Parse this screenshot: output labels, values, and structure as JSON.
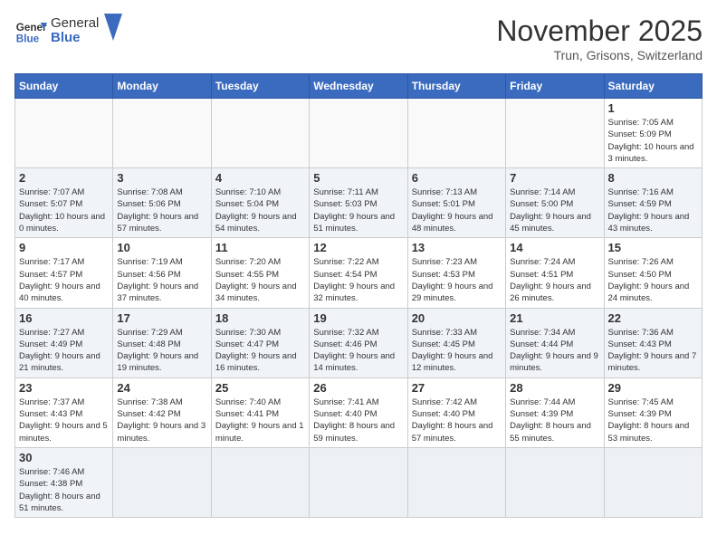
{
  "header": {
    "logo_general": "General",
    "logo_blue": "Blue",
    "month": "November 2025",
    "location": "Trun, Grisons, Switzerland"
  },
  "weekdays": [
    "Sunday",
    "Monday",
    "Tuesday",
    "Wednesday",
    "Thursday",
    "Friday",
    "Saturday"
  ],
  "weeks": [
    [
      {
        "day": "",
        "info": ""
      },
      {
        "day": "",
        "info": ""
      },
      {
        "day": "",
        "info": ""
      },
      {
        "day": "",
        "info": ""
      },
      {
        "day": "",
        "info": ""
      },
      {
        "day": "",
        "info": ""
      },
      {
        "day": "1",
        "info": "Sunrise: 7:05 AM\nSunset: 5:09 PM\nDaylight: 10 hours\nand 3 minutes."
      }
    ],
    [
      {
        "day": "2",
        "info": "Sunrise: 7:07 AM\nSunset: 5:07 PM\nDaylight: 10 hours\nand 0 minutes."
      },
      {
        "day": "3",
        "info": "Sunrise: 7:08 AM\nSunset: 5:06 PM\nDaylight: 9 hours\nand 57 minutes."
      },
      {
        "day": "4",
        "info": "Sunrise: 7:10 AM\nSunset: 5:04 PM\nDaylight: 9 hours\nand 54 minutes."
      },
      {
        "day": "5",
        "info": "Sunrise: 7:11 AM\nSunset: 5:03 PM\nDaylight: 9 hours\nand 51 minutes."
      },
      {
        "day": "6",
        "info": "Sunrise: 7:13 AM\nSunset: 5:01 PM\nDaylight: 9 hours\nand 48 minutes."
      },
      {
        "day": "7",
        "info": "Sunrise: 7:14 AM\nSunset: 5:00 PM\nDaylight: 9 hours\nand 45 minutes."
      },
      {
        "day": "8",
        "info": "Sunrise: 7:16 AM\nSunset: 4:59 PM\nDaylight: 9 hours\nand 43 minutes."
      }
    ],
    [
      {
        "day": "9",
        "info": "Sunrise: 7:17 AM\nSunset: 4:57 PM\nDaylight: 9 hours\nand 40 minutes."
      },
      {
        "day": "10",
        "info": "Sunrise: 7:19 AM\nSunset: 4:56 PM\nDaylight: 9 hours\nand 37 minutes."
      },
      {
        "day": "11",
        "info": "Sunrise: 7:20 AM\nSunset: 4:55 PM\nDaylight: 9 hours\nand 34 minutes."
      },
      {
        "day": "12",
        "info": "Sunrise: 7:22 AM\nSunset: 4:54 PM\nDaylight: 9 hours\nand 32 minutes."
      },
      {
        "day": "13",
        "info": "Sunrise: 7:23 AM\nSunset: 4:53 PM\nDaylight: 9 hours\nand 29 minutes."
      },
      {
        "day": "14",
        "info": "Sunrise: 7:24 AM\nSunset: 4:51 PM\nDaylight: 9 hours\nand 26 minutes."
      },
      {
        "day": "15",
        "info": "Sunrise: 7:26 AM\nSunset: 4:50 PM\nDaylight: 9 hours\nand 24 minutes."
      }
    ],
    [
      {
        "day": "16",
        "info": "Sunrise: 7:27 AM\nSunset: 4:49 PM\nDaylight: 9 hours\nand 21 minutes."
      },
      {
        "day": "17",
        "info": "Sunrise: 7:29 AM\nSunset: 4:48 PM\nDaylight: 9 hours\nand 19 minutes."
      },
      {
        "day": "18",
        "info": "Sunrise: 7:30 AM\nSunset: 4:47 PM\nDaylight: 9 hours\nand 16 minutes."
      },
      {
        "day": "19",
        "info": "Sunrise: 7:32 AM\nSunset: 4:46 PM\nDaylight: 9 hours\nand 14 minutes."
      },
      {
        "day": "20",
        "info": "Sunrise: 7:33 AM\nSunset: 4:45 PM\nDaylight: 9 hours\nand 12 minutes."
      },
      {
        "day": "21",
        "info": "Sunrise: 7:34 AM\nSunset: 4:44 PM\nDaylight: 9 hours\nand 9 minutes."
      },
      {
        "day": "22",
        "info": "Sunrise: 7:36 AM\nSunset: 4:43 PM\nDaylight: 9 hours\nand 7 minutes."
      }
    ],
    [
      {
        "day": "23",
        "info": "Sunrise: 7:37 AM\nSunset: 4:43 PM\nDaylight: 9 hours\nand 5 minutes."
      },
      {
        "day": "24",
        "info": "Sunrise: 7:38 AM\nSunset: 4:42 PM\nDaylight: 9 hours\nand 3 minutes."
      },
      {
        "day": "25",
        "info": "Sunrise: 7:40 AM\nSunset: 4:41 PM\nDaylight: 9 hours\nand 1 minute."
      },
      {
        "day": "26",
        "info": "Sunrise: 7:41 AM\nSunset: 4:40 PM\nDaylight: 8 hours\nand 59 minutes."
      },
      {
        "day": "27",
        "info": "Sunrise: 7:42 AM\nSunset: 4:40 PM\nDaylight: 8 hours\nand 57 minutes."
      },
      {
        "day": "28",
        "info": "Sunrise: 7:44 AM\nSunset: 4:39 PM\nDaylight: 8 hours\nand 55 minutes."
      },
      {
        "day": "29",
        "info": "Sunrise: 7:45 AM\nSunset: 4:39 PM\nDaylight: 8 hours\nand 53 minutes."
      }
    ],
    [
      {
        "day": "30",
        "info": "Sunrise: 7:46 AM\nSunset: 4:38 PM\nDaylight: 8 hours\nand 51 minutes."
      },
      {
        "day": "",
        "info": ""
      },
      {
        "day": "",
        "info": ""
      },
      {
        "day": "",
        "info": ""
      },
      {
        "day": "",
        "info": ""
      },
      {
        "day": "",
        "info": ""
      },
      {
        "day": "",
        "info": ""
      }
    ]
  ]
}
